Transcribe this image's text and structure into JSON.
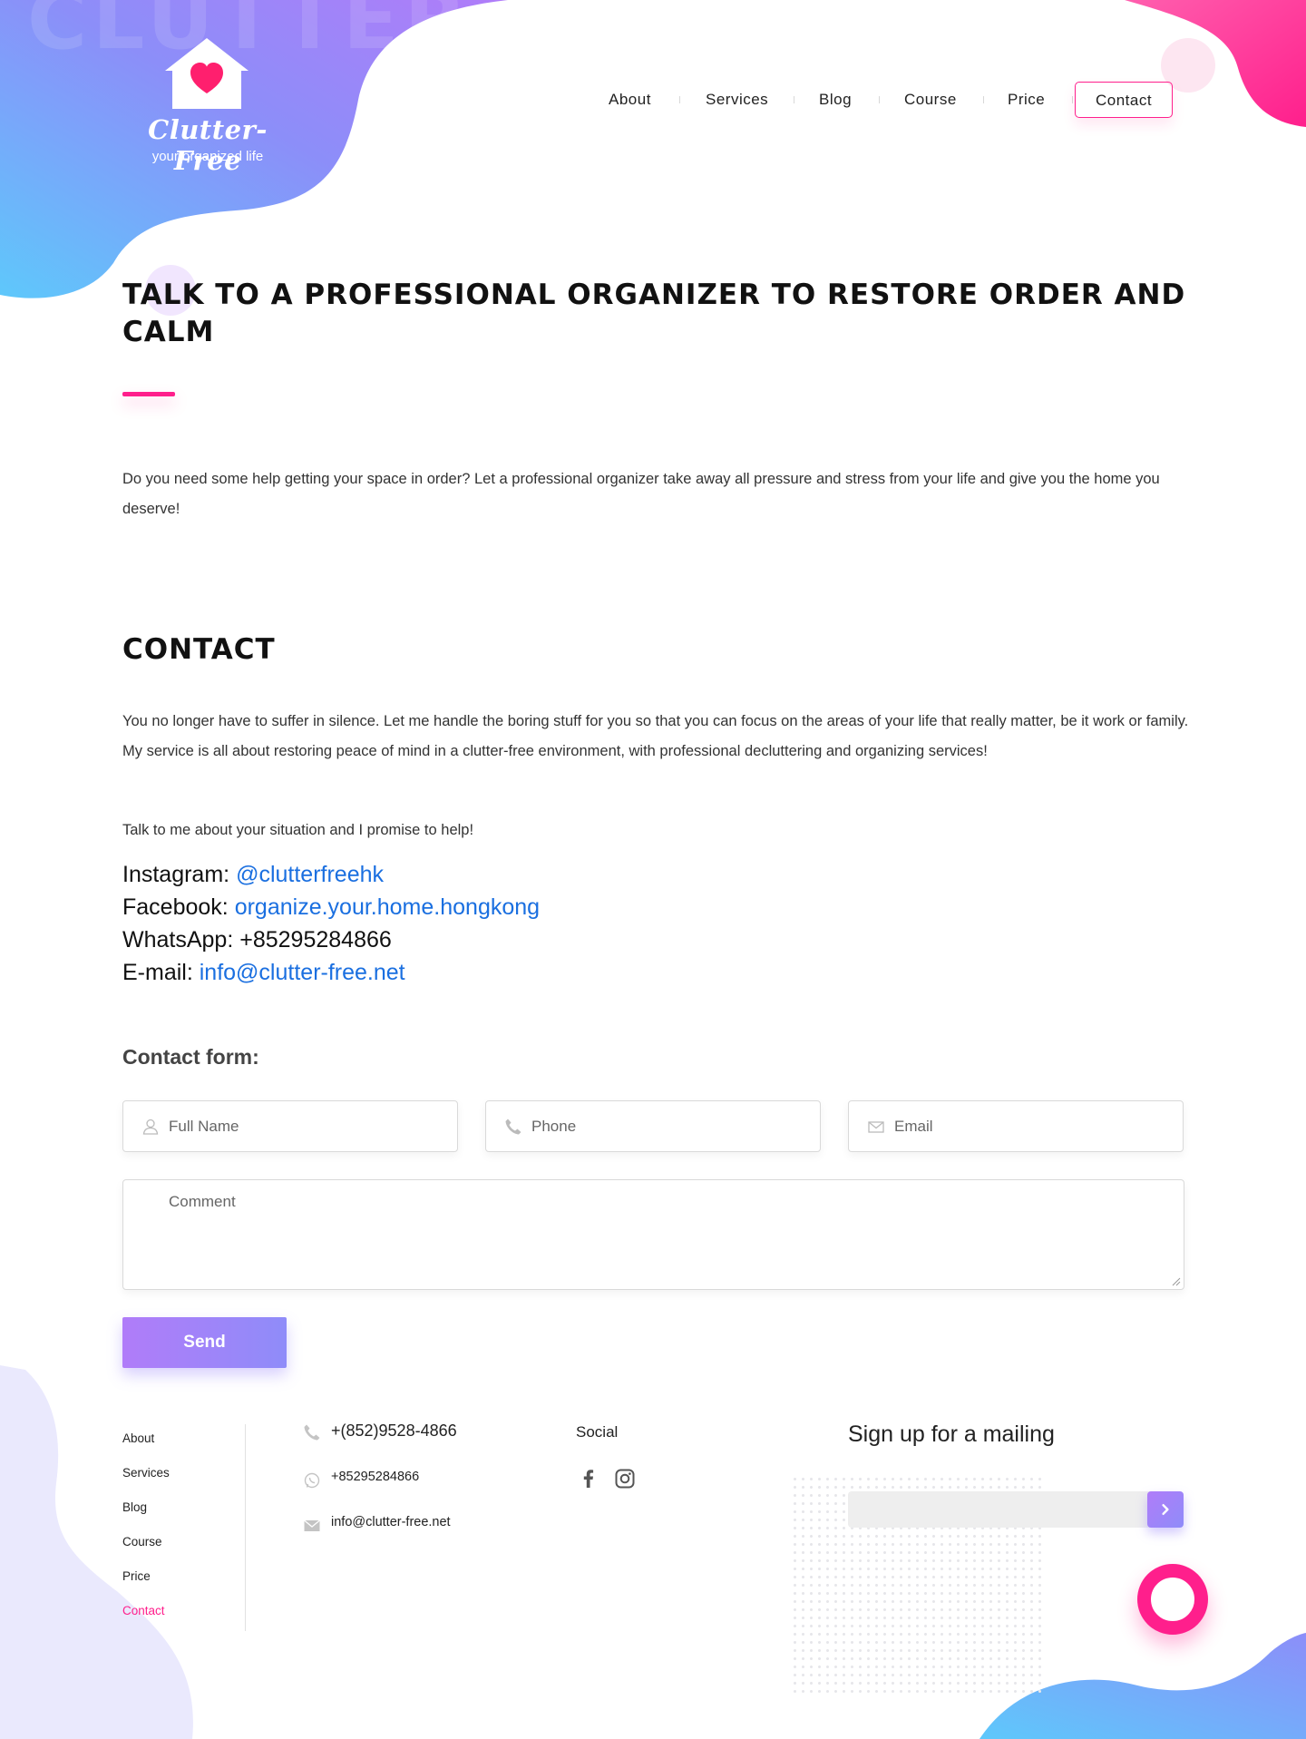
{
  "brand": {
    "name": "Clutter-Free",
    "tagline": "your organized life",
    "watermark": "CLUTTER-FREE",
    "colors": {
      "accent": "#ff1f8c",
      "gradient_start": "#5ec8fb",
      "gradient_end": "#b07cf9",
      "link": "#1a6fe0"
    }
  },
  "nav": {
    "items": [
      {
        "label": "About"
      },
      {
        "label": "Services"
      },
      {
        "label": "Blog"
      },
      {
        "label": "Course"
      },
      {
        "label": "Price"
      },
      {
        "label": "Contact",
        "active": true
      }
    ]
  },
  "hero": {
    "title": "TALK TO A PROFESSIONAL ORGANIZER TO RESTORE ORDER AND CALM",
    "text": "Do you need some help getting your space in order? Let a professional organizer take away all pressure and stress from your life and give you the home you deserve!"
  },
  "contact": {
    "title": "CONTACT",
    "paragraph1": "You no longer have to suffer in silence. Let me handle the boring stuff for you so that you can focus on the areas of your life that really matter, be it work or family. My service is all about restoring peace of mind in a clutter-free environment, with professional decluttering and organizing services!",
    "paragraph2": "Talk to me about your situation and I promise to help!",
    "instagram_label": "Instagram:",
    "instagram_value": "@clutterfreehk",
    "facebook_label": "Facebook:",
    "facebook_value": "organize.your.home.hongkong",
    "whatsapp_label": "WhatsApp:",
    "whatsapp_value": "+85295284866",
    "email_label": "E-mail:",
    "email_value": "info@clutter-free.net"
  },
  "form": {
    "heading": "Contact form:",
    "full_name_placeholder": "Full Name",
    "phone_placeholder": "Phone",
    "email_placeholder": "Email",
    "comment_placeholder": "Comment",
    "send_label": "Send",
    "icons": [
      "user-icon",
      "phone-icon",
      "envelope-icon"
    ]
  },
  "footer": {
    "nav": [
      "About",
      "Services",
      "Blog",
      "Course",
      "Price",
      "Contact"
    ],
    "active_nav": "Contact",
    "phone": "+(852)9528-4866",
    "whatsapp": "+85295284866",
    "email": "info@clutter-free.net",
    "social_title": "Social",
    "social_icons": [
      "facebook-icon",
      "instagram-icon"
    ],
    "mailing_title": "Sign up for a mailing",
    "mailing_placeholder": ""
  }
}
